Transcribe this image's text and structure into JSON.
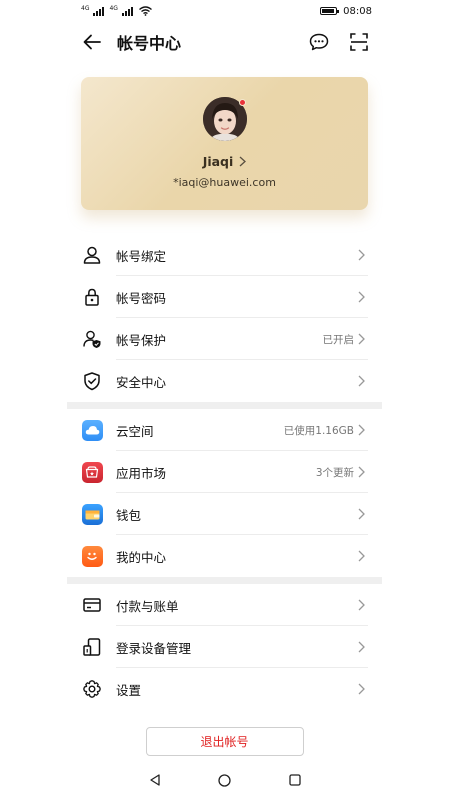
{
  "status_bar": {
    "signal1": "4G",
    "signal2": "4G",
    "time": "08:08"
  },
  "header": {
    "title": "帐号中心",
    "back_icon": "back-arrow-icon",
    "message_icon": "message-icon",
    "scan_icon": "scan-icon"
  },
  "profile": {
    "name": "Jiaqi",
    "email": "*iaqi@huawei.com",
    "badge_color": "#e8333a"
  },
  "groups": [
    {
      "items": [
        {
          "label": "帐号绑定",
          "value": "",
          "icon": "person-icon"
        },
        {
          "label": "帐号密码",
          "value": "",
          "icon": "lock-icon"
        },
        {
          "label": "帐号保护",
          "value": "已开启",
          "icon": "account-protection-icon"
        },
        {
          "label": "安全中心",
          "value": "",
          "icon": "shield-icon"
        }
      ]
    },
    {
      "items": [
        {
          "label": "云空间",
          "value": "已使用1.16GB",
          "icon": "cloud-app-icon",
          "color": "#2f8ef5"
        },
        {
          "label": "应用市场",
          "value": "3个更新",
          "icon": "appgallery-icon",
          "color": "#d9303a"
        },
        {
          "label": "钱包",
          "value": "",
          "icon": "wallet-app-icon",
          "color": "#1e88e5"
        },
        {
          "label": "我的中心",
          "value": "",
          "icon": "my-center-icon",
          "color": "#ff6a1a"
        }
      ]
    },
    {
      "items": [
        {
          "label": "付款与账单",
          "value": "",
          "icon": "card-icon"
        },
        {
          "label": "登录设备管理",
          "value": "",
          "icon": "devices-icon"
        },
        {
          "label": "设置",
          "value": "",
          "icon": "gear-icon"
        }
      ]
    }
  ],
  "logout": {
    "label": "退出帐号",
    "color": "#e02020"
  },
  "nav": {
    "back": "nav-back-icon",
    "home": "nav-home-icon",
    "recent": "nav-recent-icon"
  }
}
